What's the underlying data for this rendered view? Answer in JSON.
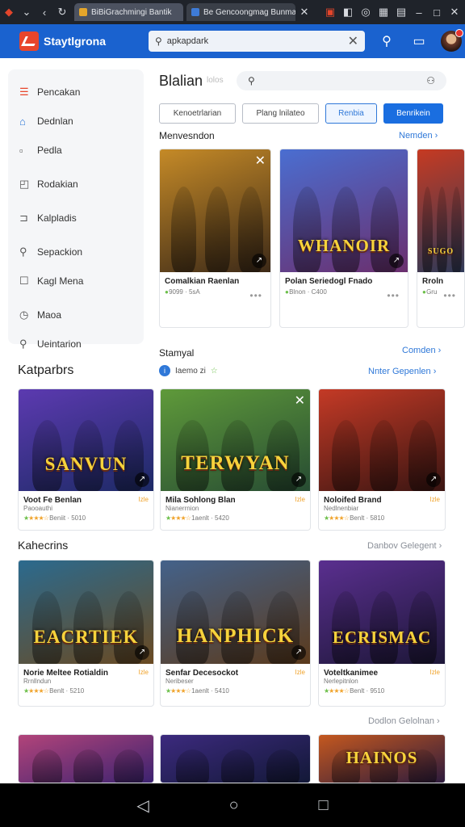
{
  "browser": {
    "tabs": [
      {
        "label": "BiBiGrachmingi Bantik",
        "color": "#e3a52b"
      },
      {
        "label": "Be Gencoongmag Bunman",
        "color": "#3e7bd6"
      }
    ]
  },
  "appbar": {
    "brand": "Staytlgrona",
    "search_value": "apkapdark"
  },
  "sidebar": {
    "items": [
      {
        "label": "Pencakan",
        "icon": "menu-icon"
      },
      {
        "label": "Dednlan",
        "icon": "home-icon"
      },
      {
        "label": "Pedla",
        "icon": "square-icon"
      },
      {
        "label": "Rodakian",
        "icon": "arrow-box-icon"
      },
      {
        "label": "Kalpladis",
        "icon": "chevron-box-icon"
      },
      {
        "label": "Sepackion",
        "icon": "search-icon"
      },
      {
        "label": "Kagl Mena",
        "icon": "checkbox-icon"
      },
      {
        "label": "Maoa",
        "icon": "clock-icon"
      },
      {
        "label": "Ueintarion",
        "icon": "search-icon"
      }
    ],
    "title": "Katparbrs"
  },
  "header": {
    "title": "Blalian",
    "subtitle": "lolos"
  },
  "chips": [
    "Kenoetrlarian",
    "Plang lnilateo",
    "Renbia",
    "Benrikein"
  ],
  "sections": {
    "s1": {
      "title": "Menvesndon",
      "link": "Nemden"
    },
    "s2": {
      "title": "Stamyal",
      "link": "Comden",
      "sub": "Iaemo zi",
      "link2": "Nnter Gepenlen"
    },
    "s3": {
      "title": "Kahecrins",
      "link": "Danbov Gelegent"
    },
    "s4": {
      "link": "Dodlon Gelolnan"
    }
  },
  "cards_top": [
    {
      "title": "Comalkian Raenlan",
      "meta": "9099 · 5sA",
      "art": "",
      "bg": [
        "#c58a27",
        "#3d2a18"
      ]
    },
    {
      "title": "Polan Seriedogl Fnado",
      "meta": "Blnon · C400",
      "art": "WHANOIR",
      "bg": [
        "#4a6ed1",
        "#6b2f6e"
      ]
    },
    {
      "title": "Rroln",
      "meta": "Gru",
      "art": "SUGO",
      "bg": [
        "#c63a22",
        "#2f3a58"
      ]
    }
  ],
  "cards_mid": [
    {
      "title": "Voot Fe Benlan",
      "sub": "Paooauthi",
      "meta": "Beniit · 5010",
      "art": "SANVUN",
      "bg": [
        "#5c3ab0",
        "#1d2a66"
      ]
    },
    {
      "title": "Mila Sohlong Blan",
      "sub": "Nianerrnion",
      "meta": "1aenlt · 5420",
      "art": "TERWYAN",
      "bg": [
        "#5f9a3a",
        "#274c33"
      ]
    },
    {
      "title": "Noloifed Brand",
      "sub": "Nedlnenbiar",
      "meta": "Benlt · 5810",
      "art": "",
      "bg": [
        "#c43a26",
        "#3a1512"
      ]
    }
  ],
  "cards_bot": [
    {
      "title": "Norie Meltee Rotialdin",
      "sub": "Rrnllndun",
      "meta": "Benlt · 5210",
      "art": "EACRTIEK",
      "bg": [
        "#2b6a8e",
        "#6a4a22"
      ]
    },
    {
      "title": "Senfar Decesockot",
      "sub": "Neribeser",
      "meta": "1aenlt · 5410",
      "art": "HANPHICK",
      "bg": [
        "#44628a",
        "#5b3a1c"
      ]
    },
    {
      "title": "Voteltkanimee",
      "sub": "Nerlepitnlon",
      "meta": "Benlt · 9510",
      "art": "ECRISMAC",
      "bg": [
        "#5a2f8f",
        "#1d1738"
      ]
    }
  ],
  "cards_last": [
    {
      "art": "",
      "bg": [
        "#b2447a",
        "#3a2270"
      ]
    },
    {
      "art": "",
      "bg": [
        "#3c2a7e",
        "#121836"
      ]
    },
    {
      "art": "HAINOS",
      "bg": [
        "#c4581f",
        "#2a1a3e"
      ]
    }
  ],
  "badge_label": "Izle"
}
